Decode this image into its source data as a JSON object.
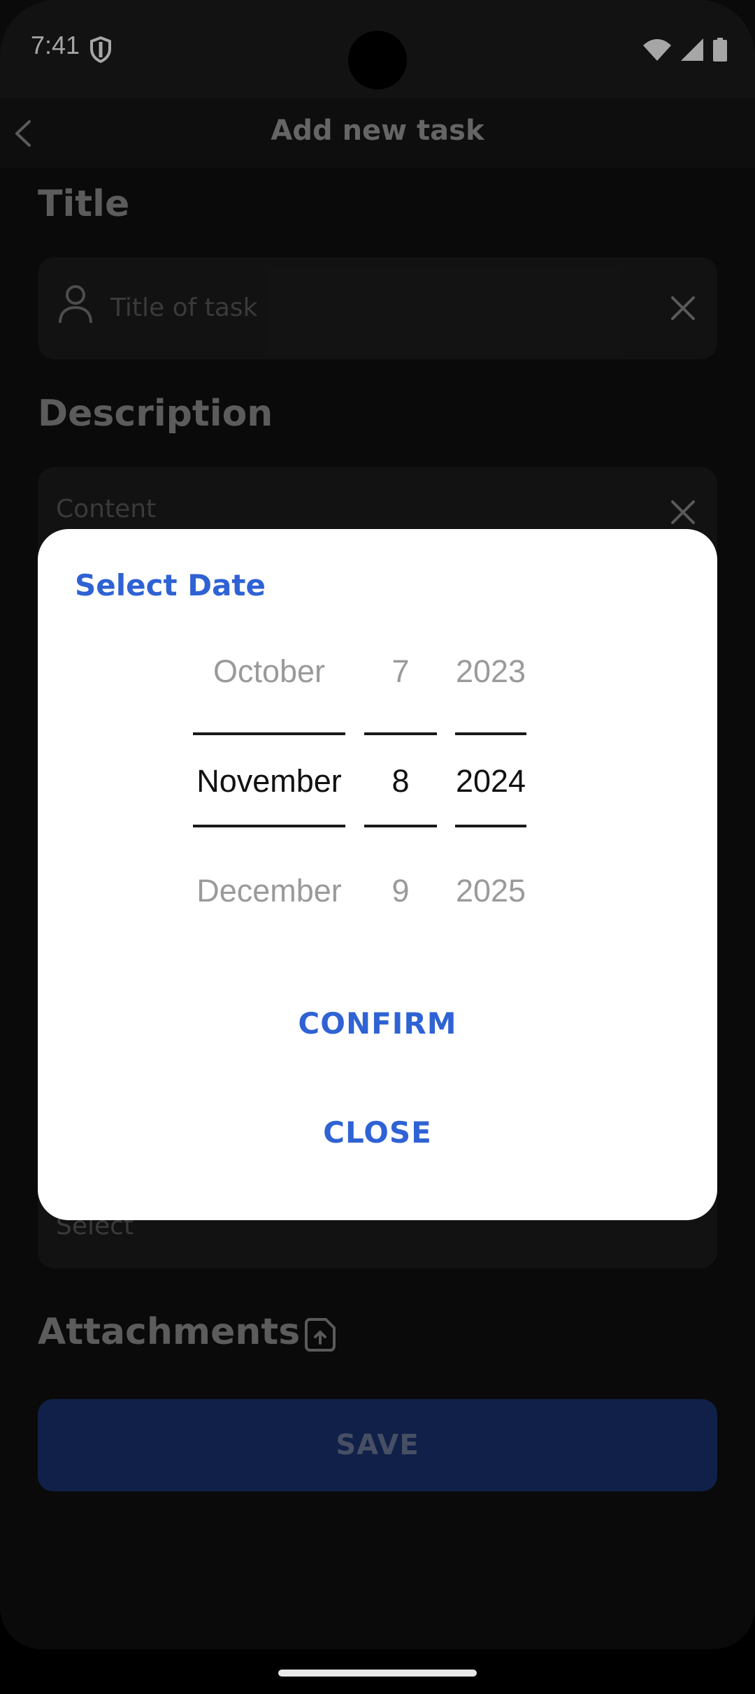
{
  "status_bar": {
    "time": "7:41"
  },
  "app_bar": {
    "title": "Add new task"
  },
  "form": {
    "title_label": "Title",
    "title_placeholder": "Title of task",
    "description_label": "Description",
    "description_placeholder": "Content",
    "select_placeholder": "Select",
    "attachments_label": "Attachments",
    "save_label": "SAVE"
  },
  "dialog": {
    "title": "Select Date",
    "months": [
      "October",
      "November",
      "December"
    ],
    "days": [
      "7",
      "8",
      "9"
    ],
    "years": [
      "2023",
      "2024",
      "2025"
    ],
    "confirm_label": "CONFIRM",
    "close_label": "CLOSE"
  },
  "colors": {
    "accent": "#2f62d4",
    "save_button": "#1a3270",
    "background": "#101010"
  }
}
